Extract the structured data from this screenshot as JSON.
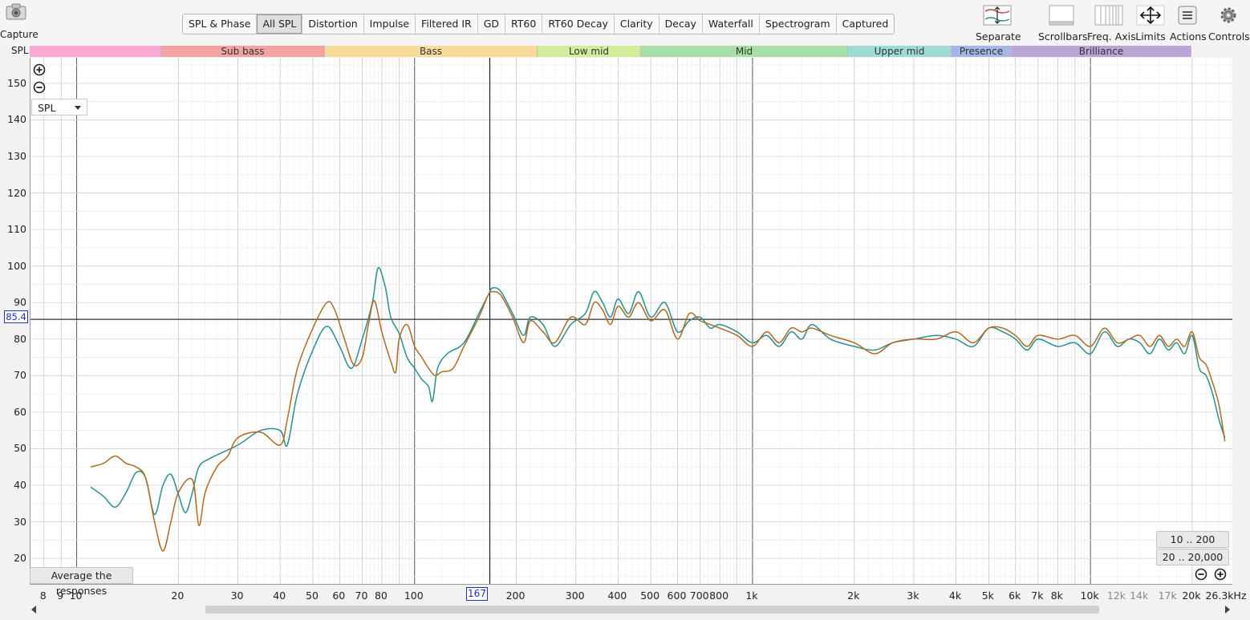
{
  "toolbar": {
    "capture_label": "Capture",
    "tabs": [
      "SPL & Phase",
      "All SPL",
      "Distortion",
      "Impulse",
      "Filtered IR",
      "GD",
      "RT60",
      "RT60 Decay",
      "Clarity",
      "Decay",
      "Waterfall",
      "Spectrogram",
      "Captured"
    ],
    "active_tab": "All SPL",
    "tools": [
      {
        "label": "Separate",
        "icon": "separate-icon"
      },
      {
        "label": "Scrollbars",
        "icon": "scrollbars-icon"
      },
      {
        "label": "Freq. Axis",
        "icon": "freq-axis-icon"
      },
      {
        "label": "Limits",
        "icon": "limits-icon"
      },
      {
        "label": "Actions",
        "icon": "actions-icon"
      },
      {
        "label": "Controls",
        "icon": "gear-icon"
      }
    ]
  },
  "bands": [
    {
      "label": "",
      "color": "#f9a8d4"
    },
    {
      "label": "Sub bass",
      "color": "#f4a3a3"
    },
    {
      "label": "Bass",
      "color": "#f9dc9c"
    },
    {
      "label": "Low mid",
      "color": "#d2ec9b"
    },
    {
      "label": "Mid",
      "color": "#a6e0a6"
    },
    {
      "label": "Upper mid",
      "color": "#9ddbd6"
    },
    {
      "label": "Presence",
      "color": "#a6b6e6"
    },
    {
      "label": "Brilliance",
      "color": "#b9a6d6"
    }
  ],
  "plot": {
    "y_axis_title": "SPL",
    "y_ticks": [
      "150",
      "140",
      "130",
      "120",
      "110",
      "100",
      "90",
      "80",
      "70",
      "60",
      "50",
      "40",
      "30",
      "20"
    ],
    "x_ticks": [
      {
        "label": "8",
        "minor": false
      },
      {
        "label": "9",
        "minor": false
      },
      {
        "label": "10",
        "minor": false
      },
      {
        "label": "20",
        "minor": false
      },
      {
        "label": "30",
        "minor": false
      },
      {
        "label": "40",
        "minor": false
      },
      {
        "label": "50",
        "minor": false
      },
      {
        "label": "60",
        "minor": false
      },
      {
        "label": "70",
        "minor": false
      },
      {
        "label": "80",
        "minor": false
      },
      {
        "label": "100",
        "minor": false
      },
      {
        "label": "200",
        "minor": false
      },
      {
        "label": "300",
        "minor": false
      },
      {
        "label": "400",
        "minor": false
      },
      {
        "label": "500",
        "minor": false
      },
      {
        "label": "600",
        "minor": false
      },
      {
        "label": "700",
        "minor": false
      },
      {
        "label": "800",
        "minor": false
      },
      {
        "label": "1k",
        "minor": false
      },
      {
        "label": "2k",
        "minor": false
      },
      {
        "label": "3k",
        "minor": false
      },
      {
        "label": "4k",
        "minor": false
      },
      {
        "label": "5k",
        "minor": false
      },
      {
        "label": "6k",
        "minor": false
      },
      {
        "label": "7k",
        "minor": false
      },
      {
        "label": "8k",
        "minor": false
      },
      {
        "label": "10k",
        "minor": false
      },
      {
        "label": "12k",
        "minor": true
      },
      {
        "label": "14k",
        "minor": true
      },
      {
        "label": "17k",
        "minor": true
      },
      {
        "label": "20k",
        "minor": false
      },
      {
        "label": "26.3kHz",
        "minor": false
      }
    ],
    "cursor_spl": "85.4",
    "cursor_freq": "167",
    "y_select": "SPL",
    "average_button": "Average the responses",
    "range_buttons": [
      "10 .. 200",
      "20 .. 20,000"
    ]
  },
  "chart_data": {
    "type": "line",
    "x_scale": "log",
    "xlim": [
      7.3,
      26300
    ],
    "ylim": [
      13,
      157
    ],
    "series": [
      {
        "color": "#2a8f8f",
        "points": [
          [
            11,
            39.5
          ],
          [
            12,
            37
          ],
          [
            13,
            34
          ],
          [
            14,
            38
          ],
          [
            15,
            43.5
          ],
          [
            16,
            42
          ],
          [
            17,
            32
          ],
          [
            18,
            40
          ],
          [
            19,
            43
          ],
          [
            20,
            37.5
          ],
          [
            21,
            32.5
          ],
          [
            22,
            38
          ],
          [
            23,
            45
          ],
          [
            25,
            47.5
          ],
          [
            30,
            51
          ],
          [
            35,
            55
          ],
          [
            40,
            55
          ],
          [
            42,
            51
          ],
          [
            45,
            65
          ],
          [
            50,
            77
          ],
          [
            55,
            83.5
          ],
          [
            60,
            78
          ],
          [
            65,
            72
          ],
          [
            70,
            80
          ],
          [
            75,
            90
          ],
          [
            78,
            99.5
          ],
          [
            82,
            94
          ],
          [
            85,
            86
          ],
          [
            90,
            81.5
          ],
          [
            95,
            75
          ],
          [
            100,
            72
          ],
          [
            105,
            69
          ],
          [
            110,
            67
          ],
          [
            113,
            63
          ],
          [
            117,
            72
          ],
          [
            125,
            76
          ],
          [
            140,
            79
          ],
          [
            155,
            87
          ],
          [
            165,
            92
          ],
          [
            170,
            94
          ],
          [
            180,
            93
          ],
          [
            195,
            87
          ],
          [
            210,
            81
          ],
          [
            220,
            86
          ],
          [
            240,
            84
          ],
          [
            260,
            78
          ],
          [
            290,
            84
          ],
          [
            320,
            87
          ],
          [
            340,
            93
          ],
          [
            360,
            90
          ],
          [
            380,
            86
          ],
          [
            400,
            91
          ],
          [
            430,
            87
          ],
          [
            460,
            93
          ],
          [
            500,
            86
          ],
          [
            550,
            90
          ],
          [
            600,
            82
          ],
          [
            650,
            85
          ],
          [
            700,
            86
          ],
          [
            750,
            83
          ],
          [
            800,
            84
          ],
          [
            900,
            82
          ],
          [
            1000,
            79
          ],
          [
            1100,
            81
          ],
          [
            1200,
            78
          ],
          [
            1300,
            82
          ],
          [
            1400,
            80
          ],
          [
            1500,
            84
          ],
          [
            1700,
            80
          ],
          [
            2000,
            78
          ],
          [
            2300,
            77
          ],
          [
            2600,
            79
          ],
          [
            3000,
            80
          ],
          [
            3500,
            81
          ],
          [
            4000,
            80
          ],
          [
            4500,
            78
          ],
          [
            5000,
            83
          ],
          [
            5500,
            82
          ],
          [
            6000,
            80
          ],
          [
            6500,
            77
          ],
          [
            7000,
            80
          ],
          [
            8000,
            78
          ],
          [
            9000,
            79
          ],
          [
            10000,
            76
          ],
          [
            11000,
            82
          ],
          [
            12000,
            78
          ],
          [
            13000,
            80
          ],
          [
            14000,
            79
          ],
          [
            15000,
            76
          ],
          [
            16000,
            80
          ],
          [
            17000,
            77
          ],
          [
            18000,
            79
          ],
          [
            19000,
            76
          ],
          [
            20000,
            81
          ],
          [
            21000,
            72
          ],
          [
            22000,
            70
          ],
          [
            23000,
            65
          ],
          [
            24000,
            58
          ],
          [
            25000,
            53
          ]
        ]
      },
      {
        "color": "#b06a25",
        "points": [
          [
            11,
            45
          ],
          [
            12,
            46
          ],
          [
            13,
            48
          ],
          [
            14,
            46
          ],
          [
            15,
            45
          ],
          [
            16,
            42
          ],
          [
            17,
            30
          ],
          [
            18,
            22
          ],
          [
            19,
            30
          ],
          [
            20,
            38
          ],
          [
            22,
            41.5
          ],
          [
            23,
            29
          ],
          [
            24,
            38
          ],
          [
            26,
            45
          ],
          [
            28,
            48
          ],
          [
            30,
            53
          ],
          [
            35,
            54.5
          ],
          [
            40,
            51
          ],
          [
            42,
            58
          ],
          [
            45,
            72
          ],
          [
            50,
            83
          ],
          [
            55,
            90
          ],
          [
            58,
            88
          ],
          [
            62,
            80
          ],
          [
            66,
            73
          ],
          [
            70,
            75
          ],
          [
            73,
            84
          ],
          [
            76,
            90.5
          ],
          [
            80,
            82
          ],
          [
            85,
            74
          ],
          [
            88,
            71
          ],
          [
            90,
            80
          ],
          [
            95,
            84
          ],
          [
            100,
            78
          ],
          [
            105,
            75
          ],
          [
            110,
            72
          ],
          [
            115,
            70
          ],
          [
            120,
            71
          ],
          [
            130,
            72
          ],
          [
            140,
            78
          ],
          [
            155,
            86
          ],
          [
            165,
            92
          ],
          [
            170,
            93
          ],
          [
            180,
            92
          ],
          [
            195,
            86
          ],
          [
            210,
            79
          ],
          [
            220,
            85
          ],
          [
            240,
            82
          ],
          [
            260,
            79
          ],
          [
            290,
            86
          ],
          [
            320,
            84
          ],
          [
            340,
            90
          ],
          [
            360,
            88
          ],
          [
            380,
            84
          ],
          [
            400,
            89
          ],
          [
            430,
            86
          ],
          [
            460,
            90
          ],
          [
            500,
            85
          ],
          [
            550,
            88
          ],
          [
            600,
            80
          ],
          [
            650,
            87
          ],
          [
            700,
            85
          ],
          [
            750,
            84
          ],
          [
            800,
            83
          ],
          [
            900,
            81
          ],
          [
            1000,
            78
          ],
          [
            1100,
            82
          ],
          [
            1200,
            79
          ],
          [
            1300,
            83
          ],
          [
            1400,
            82
          ],
          [
            1500,
            83
          ],
          [
            1700,
            81
          ],
          [
            2000,
            79
          ],
          [
            2300,
            76
          ],
          [
            2600,
            79
          ],
          [
            3000,
            80
          ],
          [
            3500,
            80
          ],
          [
            4000,
            82
          ],
          [
            4500,
            79
          ],
          [
            5000,
            83
          ],
          [
            5500,
            83
          ],
          [
            6000,
            81
          ],
          [
            6500,
            78
          ],
          [
            7000,
            81
          ],
          [
            8000,
            80
          ],
          [
            9000,
            81
          ],
          [
            10000,
            78
          ],
          [
            11000,
            83
          ],
          [
            12000,
            79
          ],
          [
            13000,
            80
          ],
          [
            14000,
            81
          ],
          [
            15000,
            78
          ],
          [
            16000,
            81
          ],
          [
            17000,
            78
          ],
          [
            18000,
            80
          ],
          [
            19000,
            78
          ],
          [
            20000,
            82
          ],
          [
            21000,
            75
          ],
          [
            22000,
            73
          ],
          [
            23000,
            68
          ],
          [
            24000,
            62
          ],
          [
            25000,
            52
          ]
        ]
      }
    ]
  }
}
